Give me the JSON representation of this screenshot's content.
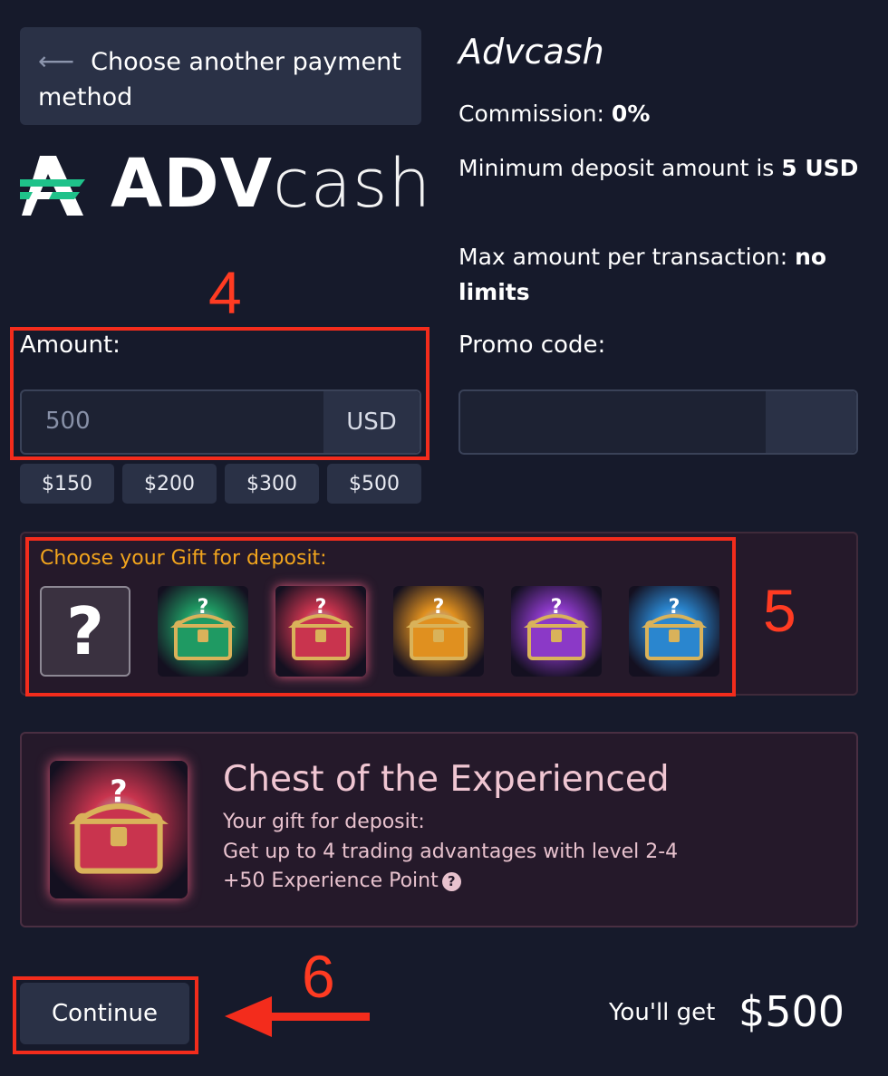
{
  "back_button": {
    "icon": "arrow-left-icon",
    "label": "Choose another payment method"
  },
  "logo": {
    "bold": "ADV",
    "light": "cash"
  },
  "method": {
    "title": "Advcash",
    "commission_label": "Commission:",
    "commission_value": "0%",
    "min_deposit_label": "Minimum deposit amount is",
    "min_deposit_value": "5 USD",
    "max_amount_label": "Max amount per transaction:",
    "max_amount_value": "no limits"
  },
  "amount": {
    "label": "Amount:",
    "value": "500",
    "currency": "USD",
    "quick_amounts": [
      "$150",
      "$200",
      "$300",
      "$500"
    ]
  },
  "promo": {
    "label": "Promo code:",
    "value": ""
  },
  "gift": {
    "title": "Choose your Gift for deposit:",
    "mystery_symbol": "?",
    "chests": [
      {
        "color": "#1f9a63"
      },
      {
        "color": "#c9344e"
      },
      {
        "color": "#e0901f"
      },
      {
        "color": "#8b39c7"
      },
      {
        "color": "#2a86cf"
      }
    ]
  },
  "selected_gift": {
    "title": "Chest of the Experienced",
    "line1": "Your gift for deposit:",
    "line2": "Get up to 4 trading advantages with level 2-4",
    "line3": "+50 Experience Point",
    "help_symbol": "?"
  },
  "continue_label": "Continue",
  "you_get": {
    "label": "You'll get",
    "value": "$500"
  },
  "annotations": {
    "step4": "4",
    "step5": "5",
    "step6": "6"
  },
  "colors": {
    "background": "#161a2b",
    "annotation_red": "#f32c1c",
    "gift_title": "#f2a51d"
  }
}
